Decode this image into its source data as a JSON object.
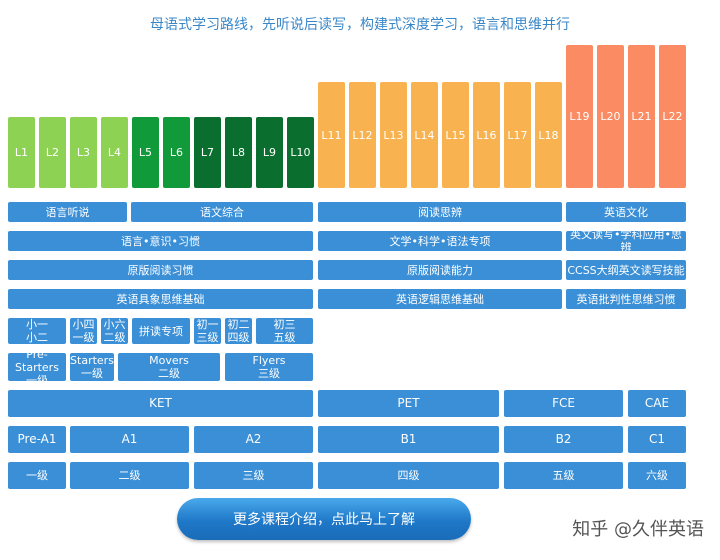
{
  "title": "母语式学习路线，先听说后读写，构建式深度学习，语言和思维并行",
  "levels": [
    "L1",
    "L2",
    "L3",
    "L4",
    "L5",
    "L6",
    "L7",
    "L8",
    "L9",
    "L10",
    "L11",
    "L12",
    "L13",
    "L14",
    "L15",
    "L16",
    "L17",
    "L18",
    "L19",
    "L20",
    "L21",
    "L22"
  ],
  "colors": {
    "light_green": "#8dd252",
    "green": "#119a39",
    "dark_green": "#0a6f2e",
    "orange": "#f8b24f",
    "salmon": "#fa8b62",
    "blue": "#3a8fd6"
  },
  "rows": {
    "r1": [
      "语言听说",
      "语文综合",
      "阅读思辨",
      "英语文化"
    ],
    "r2": [
      "语言•意识•习惯",
      "文学•科学•语法专项",
      "英文读写•学科应用•思辨"
    ],
    "r3": [
      "原版阅读习惯",
      "原版阅读能力",
      "CCSS大纲英文读写技能"
    ],
    "r4": [
      "英语具象思维基础",
      "英语逻辑思维基础",
      "英语批判性思维习惯"
    ],
    "r5": [
      "小一\n小二",
      "小四\n一级",
      "小六\n二级",
      "拼读专项",
      "初一\n三级",
      "初二\n四级",
      "初三\n五级"
    ],
    "r6": [
      "Pre-Starters\n一级",
      "Starters\n一级",
      "Movers\n二级",
      "Flyers\n三级"
    ],
    "r7": [
      "KET",
      "PET",
      "FCE",
      "CAE"
    ],
    "r8": [
      "Pre-A1",
      "A1",
      "A2",
      "B1",
      "B2",
      "C1"
    ],
    "r9": [
      "一级",
      "二级",
      "三级",
      "四级",
      "五级",
      "六级"
    ]
  },
  "button": "更多课程介绍，点此马上了解",
  "watermark": "知乎 @久伴英语"
}
